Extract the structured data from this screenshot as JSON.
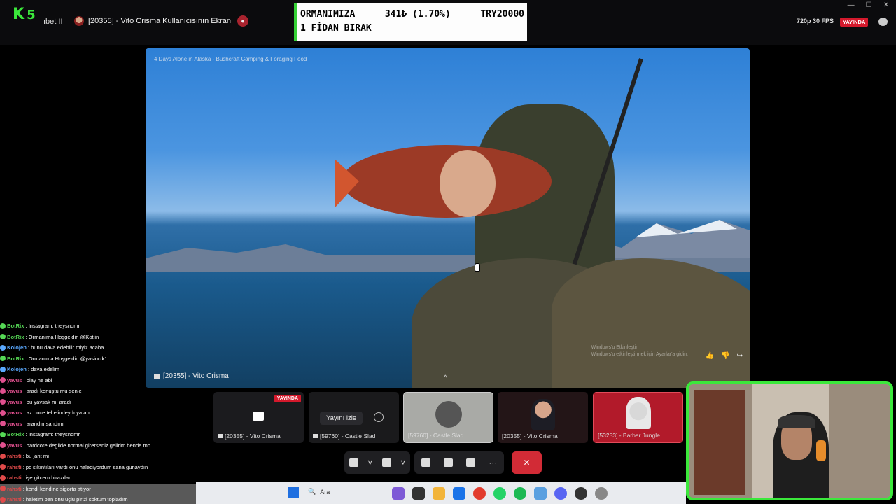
{
  "header": {
    "logo_letter": "K",
    "logo_number": "5",
    "prev_window_title": "ıbet II",
    "window_title": "[20355] - Vito Crisma Kullanıcısının Ekranı",
    "quality": "720p 30 FPS",
    "live_badge": "YAYINDA",
    "window_controls": [
      "—",
      "☐",
      "✕"
    ]
  },
  "donation": {
    "line1_left": "ORMANIMIZA",
    "line1_amount": "341₺ (1.70%)",
    "line1_goal": "TRY20000",
    "line2": "1 FİDAN BIRAK"
  },
  "video": {
    "title": "4 Days Alone in Alaska - Bushcraft Camping & Foraging Food",
    "sharer_name": "[20355] - Vito Crisma",
    "watermark_1": "Windows'u Etkinleştir",
    "watermark_2": "Windows'u etkinleştirmek için Ayarlar'a gidin."
  },
  "participants": [
    {
      "label": "[20355] - Vito Crisma",
      "badge": "YAYINDA"
    },
    {
      "label": "[59760] - Castle Slad",
      "watch_label": "Yayını izle"
    },
    {
      "label": "[59760] - Castle Slad"
    },
    {
      "label": "[20355] - Vito Crisma"
    },
    {
      "label": "[53253] - Barbar Jungle"
    }
  ],
  "call_controls": {
    "more": "···",
    "hangup": "✕"
  },
  "chat": [
    {
      "user": "BotRix",
      "color": "#55d855",
      "text": ": Instagram: theysndmr"
    },
    {
      "user": "BotRix",
      "color": "#55d855",
      "text": ": Ormanıma Hoşgeldin @Kotlin"
    },
    {
      "user": "Kolojen",
      "color": "#5aa9ff",
      "text": ": bunu dava edebilir miyiz acaba"
    },
    {
      "user": "BotRix",
      "color": "#55d855",
      "text": ": Ormanıma Hoşgeldin @yasincik1"
    },
    {
      "user": "Kolojen",
      "color": "#5aa9ff",
      "text": ": dava edelim"
    },
    {
      "user": "yavus",
      "color": "#e0508e",
      "text": ": olay ne abi"
    },
    {
      "user": "yavus",
      "color": "#e0508e",
      "text": ": aradı konuştu mu senle"
    },
    {
      "user": "yavus",
      "color": "#e0508e",
      "text": ": bu yavsak mı aradı"
    },
    {
      "user": "yavus",
      "color": "#e0508e",
      "text": ": az once tel elindeydı ya abi"
    },
    {
      "user": "yavus",
      "color": "#e0508e",
      "text": ": arandın sandım"
    },
    {
      "user": "BotRix",
      "color": "#55d855",
      "text": ": Instagram: theysndmr"
    },
    {
      "user": "yavus",
      "color": "#e0508e",
      "text": ": hardcore degilde normal girerseniz gelirim bende mc"
    },
    {
      "user": "rahsti",
      "color": "#e04a4a",
      "text": ": bu jant mı"
    },
    {
      "user": "rahsti",
      "color": "#e04a4a",
      "text": ": pc sıkıntıları vardı onu halediyordum sana gunaydın"
    },
    {
      "user": "rahsti",
      "color": "#e04a4a",
      "text": ": işe gitcem birazdan"
    },
    {
      "user": "rahsti",
      "color": "#e04a4a",
      "text": ": kendi kendine sigorta atıyor"
    },
    {
      "user": "rahsti",
      "color": "#e04a4a",
      "text": ": haletim ben onu üçlü pirizi söktüm topladım"
    }
  ],
  "taskbar": {
    "search_placeholder": "Ara"
  },
  "colors": {
    "accent_green": "#3be83b",
    "live_red": "#d4192c",
    "hangup_red": "#d22b36"
  }
}
